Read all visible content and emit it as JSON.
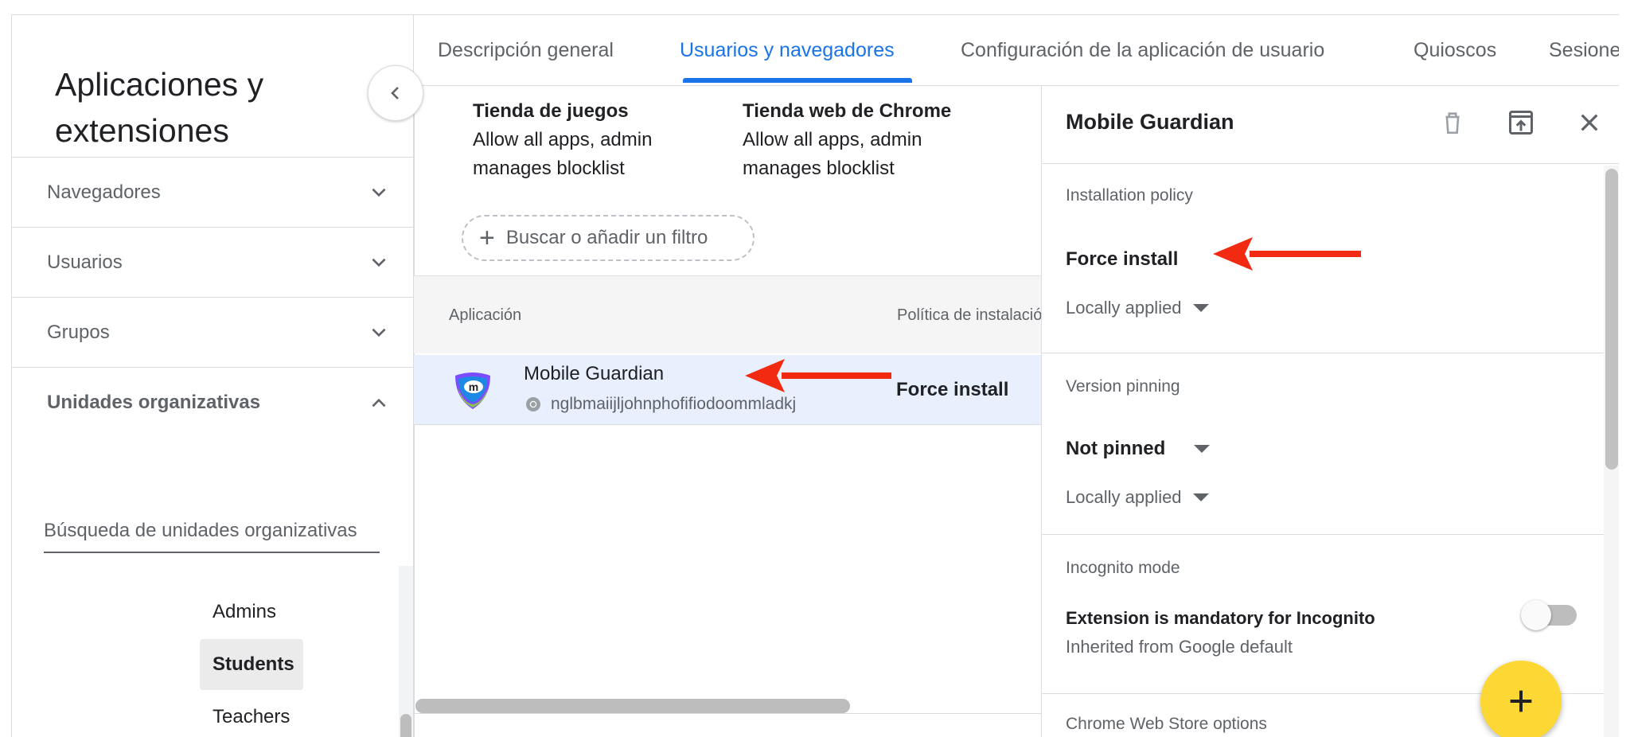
{
  "sidebar": {
    "title": "Aplicaciones y extensiones",
    "sections": [
      {
        "label": "Navegadores",
        "expanded": false
      },
      {
        "label": "Usuarios",
        "expanded": false
      },
      {
        "label": "Grupos",
        "expanded": false
      },
      {
        "label": "Unidades organizativas",
        "expanded": true
      }
    ],
    "ou_search_placeholder": "Búsqueda de unidades organizativas",
    "ou_items": [
      {
        "label": "Admins",
        "selected": false
      },
      {
        "label": "Students",
        "selected": true
      },
      {
        "label": "Teachers",
        "selected": false
      }
    ]
  },
  "tabs": [
    {
      "label": "Descripción general",
      "active": false
    },
    {
      "label": "Usuarios y navegadores",
      "active": true
    },
    {
      "label": "Configuración de la aplicación de usuario",
      "active": false
    },
    {
      "label": "Quioscos",
      "active": false
    },
    {
      "label": "Sesiones",
      "active": false
    }
  ],
  "stores": [
    {
      "title": "Tienda de juegos",
      "line1": "Allow all apps, admin",
      "line2": "manages blocklist"
    },
    {
      "title": "Tienda web de Chrome",
      "line1": "Allow all apps, admin",
      "line2": "manages blocklist"
    }
  ],
  "filter": {
    "label": "Buscar o añadir un filtro"
  },
  "table": {
    "headers": [
      "Aplicación",
      "Política de instalación"
    ],
    "rows": [
      {
        "name": "Mobile Guardian",
        "id": "nglbmaiijljohnphofifiodoommladkj",
        "policy": "Force install"
      }
    ]
  },
  "panel": {
    "title": "Mobile Guardian",
    "installation": {
      "label": "Installation policy",
      "value": "Force install",
      "sub": "Locally applied"
    },
    "version": {
      "label": "Version pinning",
      "value": "Not pinned",
      "sub": "Locally applied"
    },
    "incognito": {
      "label": "Incognito mode",
      "value": "Extension is mandatory for Incognito",
      "sub": "Inherited from Google default",
      "enabled": false
    },
    "cws": {
      "label": "Chrome Web Store options"
    }
  },
  "colors": {
    "accent": "#1a73e8",
    "annotation_arrow": "#f32a12",
    "fab": "#fdd835",
    "selected_row": "#e8f0fe"
  },
  "icons": [
    "chevron-left-icon",
    "chevron-down-icon",
    "chevron-up-icon",
    "plus-icon",
    "chrome-icon",
    "app-logo-icon",
    "delete-icon",
    "open-in-new-icon",
    "close-icon",
    "caret-down-icon"
  ]
}
